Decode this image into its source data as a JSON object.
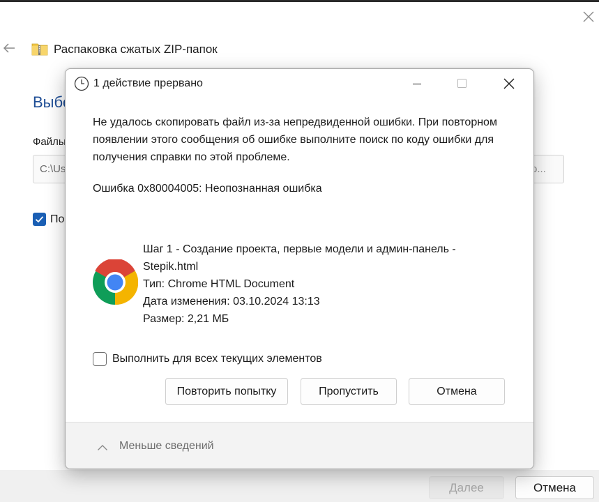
{
  "wizard": {
    "title": "Распаковка сжатых ZIP-папок",
    "heading": "Выбе",
    "files_label": "Файлы",
    "path_value": "C:\\Us",
    "browse_tail": "о...",
    "checkbox_label": "По",
    "checkbox_checked": true,
    "next_label": "Далее",
    "cancel_label": "Отмена"
  },
  "dialog": {
    "title": "1 действие прервано",
    "message": "Не удалось скопировать файл из-за непредвиденной ошибки. При повторном появлении этого сообщения об ошибке выполните поиск по коду ошибки для получения справки по этой проблеме.",
    "error": "Ошибка 0x80004005: Неопознанная ошибка",
    "file": {
      "name_line1": "Шаг 1 - Создание проекта, первые модели и админ-панель -",
      "name_line2": "Stepik.html",
      "type": "Тип: Chrome HTML Document",
      "modified": "Дата изменения: 03.10.2024 13:13",
      "size": "Размер: 2,21 МБ"
    },
    "apply_all_label": "Выполнить для всех текущих элементов",
    "apply_all_checked": false,
    "buttons": {
      "retry": "Повторить попытку",
      "skip": "Пропустить",
      "cancel": "Отмена"
    },
    "less_details": "Меньше сведений"
  },
  "icons": {
    "window_close": "close-icon",
    "back": "back-arrow-icon",
    "zip_folder": "zip-folder-icon",
    "clock": "clock-icon",
    "minimize": "minimize-icon",
    "maximize": "maximize-icon",
    "file": "chrome-icon",
    "chevron": "chevron-up-icon"
  },
  "colors": {
    "accent": "#1a5fb4",
    "heading": "#1f4e96",
    "chrome_red": "#db4437",
    "chrome_green": "#0f9d58",
    "chrome_yellow": "#f4b400",
    "chrome_blue": "#4285f4"
  }
}
